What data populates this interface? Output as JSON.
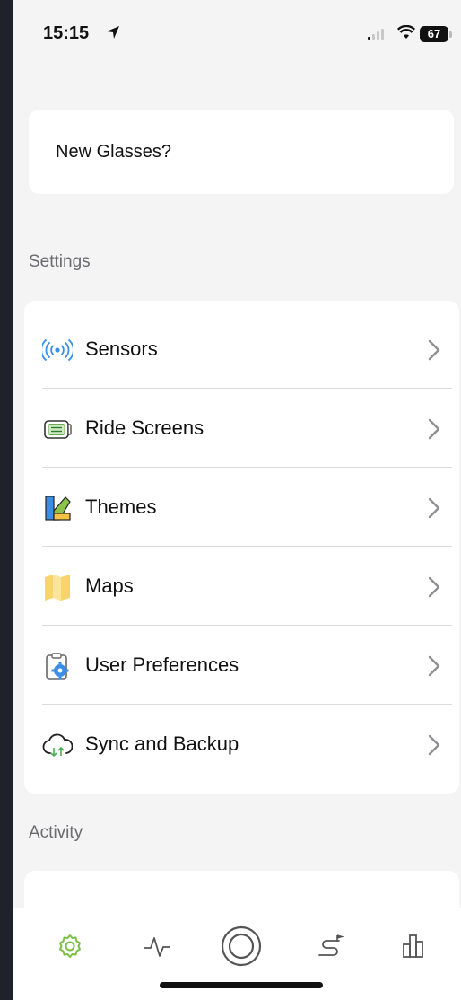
{
  "status_bar": {
    "time": "15:15",
    "battery": "67"
  },
  "promo": {
    "text": "New Glasses?"
  },
  "sections": {
    "settings": "Settings",
    "activity": "Activity"
  },
  "settings_items": [
    {
      "label": "Sensors",
      "icon": "sensors-icon"
    },
    {
      "label": "Ride Screens",
      "icon": "ride-screens-icon"
    },
    {
      "label": "Themes",
      "icon": "themes-icon"
    },
    {
      "label": "Maps",
      "icon": "maps-icon"
    },
    {
      "label": "User Preferences",
      "icon": "user-preferences-icon"
    },
    {
      "label": "Sync and Backup",
      "icon": "sync-backup-icon"
    }
  ],
  "tab_bar": {
    "items": [
      "settings-gear",
      "activity-pulse",
      "record-ring",
      "routes",
      "stats-bars"
    ],
    "active_color": "#7bc043"
  }
}
